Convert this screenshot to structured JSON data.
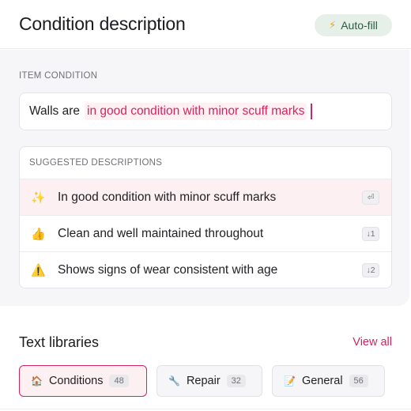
{
  "header": {
    "title": "Condition description",
    "autofill_label": "Auto-fill",
    "autofill_icon": "lightning-icon"
  },
  "condition": {
    "label": "ITEM CONDITION",
    "typed_text": "Walls are",
    "inline_suggestion": "in good condition with minor scuff marks"
  },
  "suggestions": {
    "header": "SUGGESTED DESCRIPTIONS",
    "items": [
      {
        "emoji": "✨",
        "text": "In good condition with minor scuff marks",
        "shortcut": "⏎",
        "active": true
      },
      {
        "emoji": "👍",
        "text": "Clean and well maintained throughout",
        "shortcut": "↓1"
      },
      {
        "emoji": "⚠️",
        "text": "Shows signs of wear consistent with age",
        "shortcut": "↓2"
      }
    ]
  },
  "libraries": {
    "title": "Text libraries",
    "view_all": "View all",
    "chips": [
      {
        "icon": "🏠",
        "label": "Conditions",
        "count": "48",
        "active": true
      },
      {
        "icon": "🔧",
        "label": "Repair",
        "count": "32"
      },
      {
        "icon": "📝",
        "label": "General",
        "count": "56"
      }
    ]
  },
  "colors": {
    "accent": "#d0265e",
    "autofill_bg": "#e7efe9",
    "autofill_text": "#2c5b3e"
  }
}
